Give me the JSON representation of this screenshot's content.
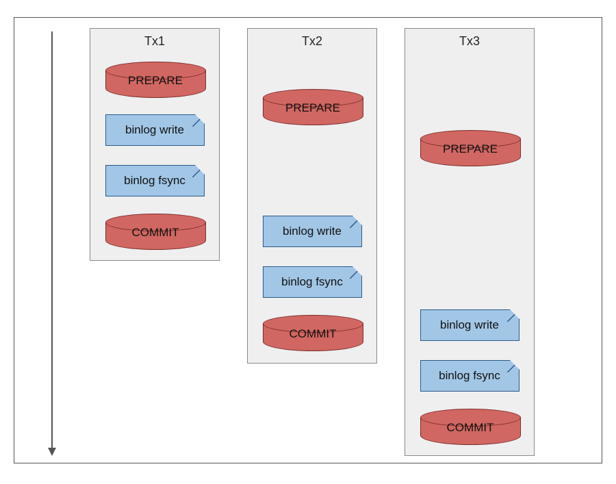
{
  "columns": [
    {
      "title": "Tx1"
    },
    {
      "title": "Tx2"
    },
    {
      "title": "Tx3"
    }
  ],
  "steps": {
    "prepare": "PREPARE",
    "binlog_write": "binlog write",
    "binlog_fsync": "binlog fsync",
    "commit": "COMMIT"
  },
  "colors": {
    "disk": "#d16762",
    "card": "#a2c6e6",
    "column_bg": "#efefef"
  }
}
